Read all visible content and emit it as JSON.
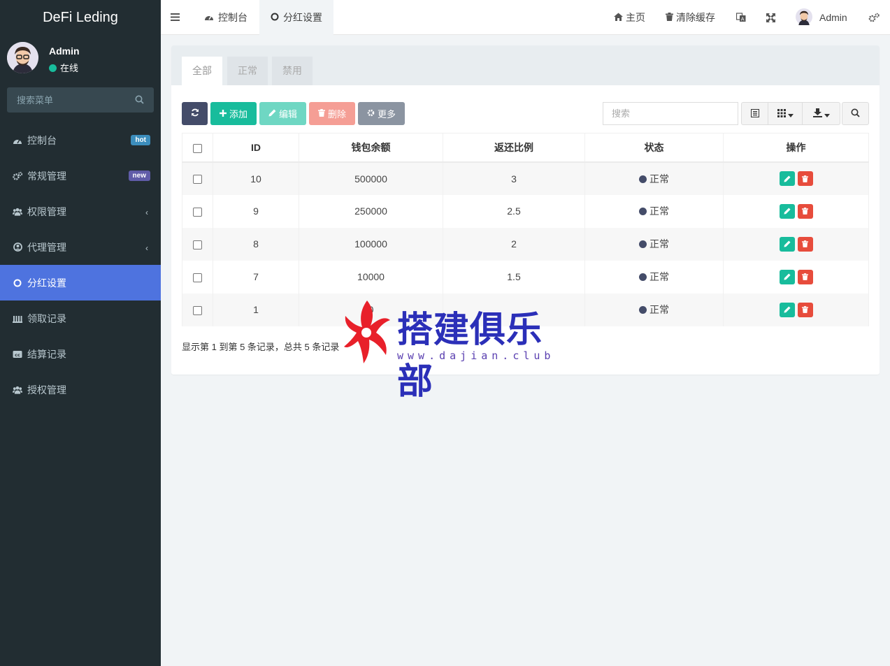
{
  "app": {
    "title": "DeFi Leding"
  },
  "user": {
    "name": "Admin",
    "status": "在线"
  },
  "sidebar": {
    "search_placeholder": "搜索菜单",
    "items": [
      {
        "label": "控制台",
        "icon": "dashboard-icon",
        "badge": "hot"
      },
      {
        "label": "常规管理",
        "icon": "cogs-icon",
        "badge": "new"
      },
      {
        "label": "权限管理",
        "icon": "users-icon",
        "chevron": "‹"
      },
      {
        "label": "代理管理",
        "icon": "user-circle-icon",
        "chevron": "‹"
      },
      {
        "label": "分红设置",
        "icon": "circle-icon",
        "active": true
      },
      {
        "label": "领取记录",
        "icon": "list-icon"
      },
      {
        "label": "结算记录",
        "icon": "cc-icon"
      },
      {
        "label": "授权管理",
        "icon": "users-icon"
      }
    ]
  },
  "topbar": {
    "tabs": [
      {
        "label": "控制台"
      },
      {
        "label": "分红设置"
      }
    ],
    "home": "主页",
    "clear_cache": "清除缓存",
    "admin": "Admin"
  },
  "filter_tabs": [
    "全部",
    "正常",
    "禁用"
  ],
  "toolbar": {
    "add": "添加",
    "edit": "编辑",
    "delete": "删除",
    "more": "更多",
    "search_placeholder": "搜索"
  },
  "table": {
    "columns": [
      "ID",
      "钱包余额",
      "返还比例",
      "状态",
      "操作"
    ],
    "rows": [
      {
        "id": "10",
        "balance": "500000",
        "ratio": "3",
        "status": "正常"
      },
      {
        "id": "9",
        "balance": "250000",
        "ratio": "2.5",
        "status": "正常"
      },
      {
        "id": "8",
        "balance": "100000",
        "ratio": "2",
        "status": "正常"
      },
      {
        "id": "7",
        "balance": "10000",
        "ratio": "1.5",
        "status": "正常"
      },
      {
        "id": "1",
        "balance": "0",
        "ratio": "",
        "status": "正常"
      }
    ]
  },
  "pager": "显示第 1 到第 5 条记录，总共 5 条记录",
  "watermark": {
    "text": "搭建俱乐部",
    "url": "www.dajian.club"
  },
  "colors": {
    "sidebar": "#222d32",
    "active": "#4e73df",
    "success": "#18bc9c",
    "danger": "#e74c3c"
  }
}
